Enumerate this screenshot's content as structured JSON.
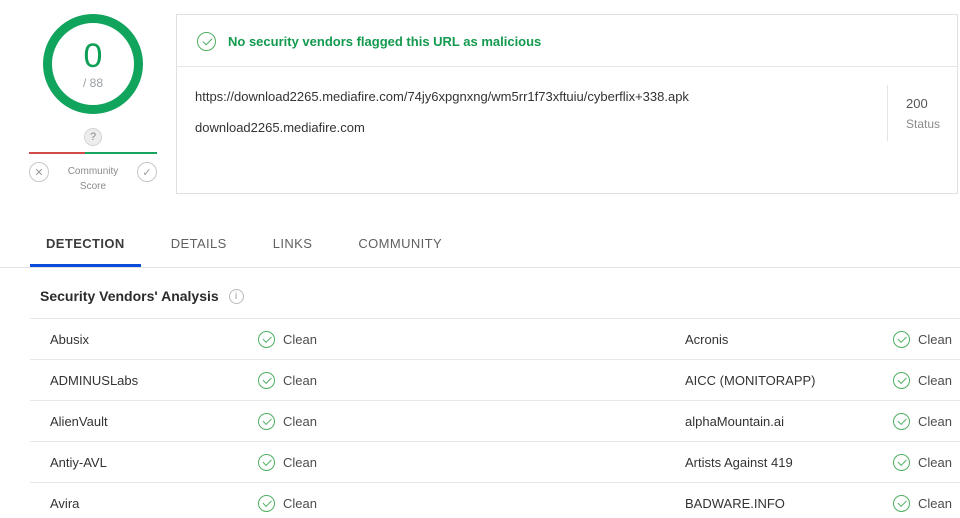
{
  "score": {
    "value": "0",
    "total": "/ 88",
    "badge": "?",
    "community_label_line1": "Community",
    "community_label_line2": "Score",
    "vote_down": "✕",
    "vote_up": "✓"
  },
  "summary": {
    "flag_message": "No security vendors flagged this URL as malicious",
    "url": "https://download2265.mediafire.com/74jy6xpgnxng/wm5rr1f73xftuiu/cyberflix+338.apk",
    "domain": "download2265.mediafire.com",
    "status_code": "200",
    "status_label": "Status"
  },
  "tabs": [
    {
      "label": "DETECTION",
      "active": true
    },
    {
      "label": "DETAILS",
      "active": false
    },
    {
      "label": "LINKS",
      "active": false
    },
    {
      "label": "COMMUNITY",
      "active": false
    }
  ],
  "analysis": {
    "title": "Security Vendors' Analysis",
    "info_icon": "i",
    "rows": [
      [
        {
          "vendor": "Abusix",
          "result": "Clean"
        },
        {
          "vendor": "Acronis",
          "result": "Clean"
        }
      ],
      [
        {
          "vendor": "ADMINUSLabs",
          "result": "Clean"
        },
        {
          "vendor": "AICC (MONITORAPP)",
          "result": "Clean"
        }
      ],
      [
        {
          "vendor": "AlienVault",
          "result": "Clean"
        },
        {
          "vendor": "alphaMountain.ai",
          "result": "Clean"
        }
      ],
      [
        {
          "vendor": "Antiy-AVL",
          "result": "Clean"
        },
        {
          "vendor": "Artists Against 419",
          "result": "Clean"
        }
      ],
      [
        {
          "vendor": "Avira",
          "result": "Clean"
        },
        {
          "vendor": "BADWARE.INFO",
          "result": "Clean"
        }
      ]
    ]
  },
  "colors": {
    "accent_green": "#11a45c",
    "message_green": "#139a4e",
    "tab_active_blue": "#0b4dda",
    "bar_red": "#d14b4b"
  }
}
